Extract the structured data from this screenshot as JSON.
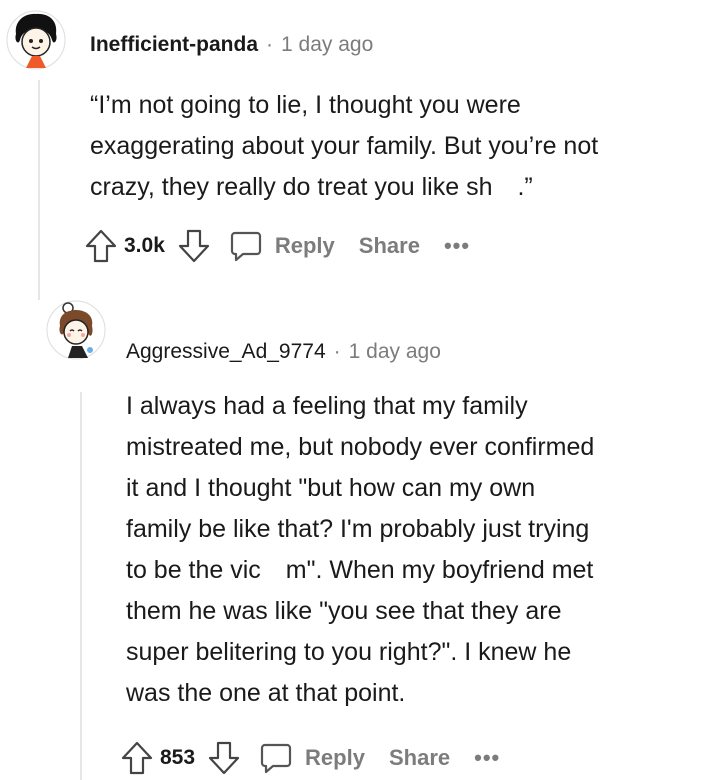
{
  "comments": [
    {
      "username": "Inefficient-panda",
      "separator": "·",
      "time": "1 day ago",
      "body": "“I’m not going to lie, I thought you were\nexaggerating about your family. But you’re not\ncrazy, they really do treat you like sh  .”",
      "score": "3.0k",
      "reply_label": "Reply",
      "share_label": "Share",
      "more_label": "•••"
    },
    {
      "username": "Aggressive_Ad_9774",
      "separator": "·",
      "time": "1 day ago",
      "body": "I always had a feeling that my family\nmistreated me, but nobody ever confirmed\nit and I thought \"but how can my own\nfamily be like that? I'm probably just trying\nto be the vic  m\". When my boyfriend met\nthem he was like \"you see that they are\nsuper belitering to you right?\". I knew he\nwas the one at that point.",
      "score": "853",
      "reply_label": "Reply",
      "share_label": "Share",
      "more_label": "•••"
    }
  ],
  "colors": {
    "text": "#1a1a1b",
    "meta": "#7c7c7c",
    "thread_line": "#e4e6e8",
    "avatar_accent": "#f05a28"
  }
}
